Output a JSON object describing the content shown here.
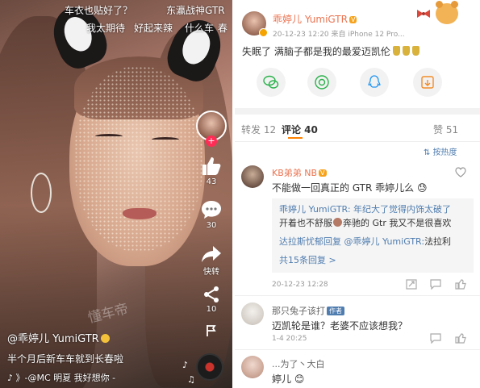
{
  "video": {
    "danmaku": [
      "车衣也贴好了？",
      "东瀛战神GTR",
      "我太期待",
      "好起来辣",
      "什么车",
      "春"
    ],
    "like_count": "43",
    "comment_count": "30",
    "share_label": "快转",
    "forward_count": "10",
    "author": "@乖婷儿 YumiGTR",
    "caption": "半个月后新车车就到长春啦",
    "music": "♪ 》-@MC 明夏   我好想你 -",
    "watermark": "懂车帝",
    "icons": {
      "like": "thumbs-up-icon",
      "comment": "speech-bubble-icon",
      "share": "share-arrow-icon",
      "forward": "forward-icon",
      "report": "flag-icon",
      "music": "music-disc-icon"
    }
  },
  "weibo": {
    "author": "乖婷儿 YumiGTR",
    "level": "V",
    "meta": "20-12-23 12:20  来自 iPhone 12 Pro...",
    "post_text": "失眠了 满脑子都是我的最爱迈凯伦",
    "share_targets": [
      "wechat-icon",
      "moments-icon",
      "qq-icon",
      "save-image-icon"
    ],
    "tabs": {
      "repost": "转发 12",
      "comment": "评论 40",
      "like": "赞 51"
    },
    "sort_label": "按热度",
    "comments": [
      {
        "user": "KB弟弟 NB",
        "text": "不能做一回真正的 GTR 乖婷儿么",
        "replies": {
          "r1": "乖婷儿 YumiGTR: 年纪大了觉得内饰太破了",
          "r2_a": "开着也不舒服",
          "r2_b": "奔驰的 Gtr 我又不是很喜欢",
          "r3_name": "达拉斯忧郁回复 @乖婷儿 YumiGTR:",
          "r3_text": "法拉利",
          "more": "共15条回复 >"
        },
        "time": "20-12-23 12:28"
      },
      {
        "user": "那只兔子该打",
        "tag": "作者",
        "text": "迈凯轮是谁？老婆不应该想我？",
        "time": "1-4 20:25"
      },
      {
        "user": "...为了丶大白",
        "text": "婷儿"
      }
    ],
    "colors": {
      "name_orange": "#eb7350",
      "link_blue": "#507daf",
      "tab_accent": "#ff8200"
    }
  }
}
